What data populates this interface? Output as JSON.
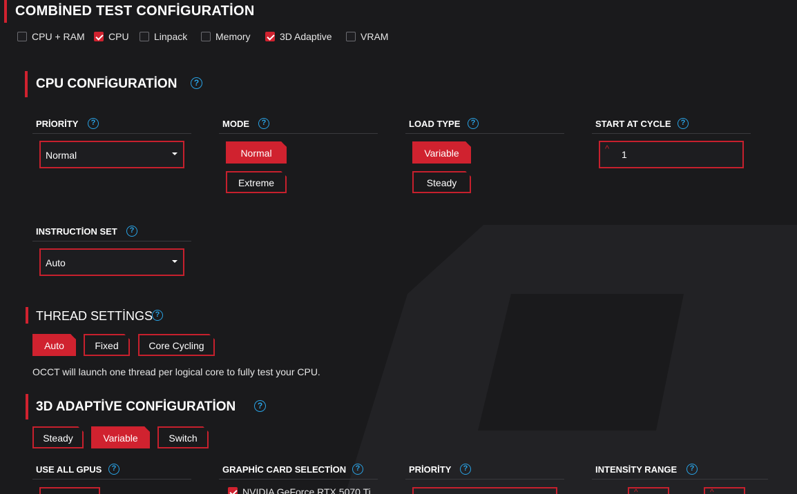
{
  "combined": {
    "title": "COMBİNED TEST CONFİGURATİON",
    "tests": [
      {
        "label": "CPU + RAM",
        "checked": false
      },
      {
        "label": "CPU",
        "checked": true
      },
      {
        "label": "Linpack",
        "checked": false
      },
      {
        "label": "Memory",
        "checked": false
      },
      {
        "label": "3D Adaptive",
        "checked": true
      },
      {
        "label": "VRAM",
        "checked": false
      }
    ]
  },
  "cpu": {
    "title": "CPU CONFİGURATİON",
    "priority": {
      "label": "PRİORİTY",
      "value": "Normal"
    },
    "mode": {
      "label": "MODE",
      "options": [
        "Normal",
        "Extreme"
      ],
      "selected": "Normal"
    },
    "load_type": {
      "label": "LOAD TYPE",
      "options": [
        "Variable",
        "Steady"
      ],
      "selected": "Variable"
    },
    "start_cycle": {
      "label": "START AT CYCLE",
      "value": "1"
    },
    "instruction_set": {
      "label": "INSTRUCTİON SET",
      "value": "Auto"
    }
  },
  "threads": {
    "title": "THREAD SETTİNGS",
    "options": [
      "Auto",
      "Fixed",
      "Core Cycling"
    ],
    "selected": "Auto",
    "description": "OCCT will launch one thread per logical core to fully test your CPU."
  },
  "adaptive": {
    "title": "3D ADAPTİVE CONFİGURATİON",
    "options": [
      "Steady",
      "Variable",
      "Switch"
    ],
    "selected": "Variable",
    "use_all_gpus": {
      "label": "USE ALL GPUS"
    },
    "gpu_selection": {
      "label": "GRAPHİC CARD SELECTİON",
      "items": [
        {
          "label": "NVIDIA GeForce RTX 5070 Ti",
          "checked": true
        }
      ]
    },
    "priority": {
      "label": "PRİORİTY"
    },
    "intensity": {
      "label": "INTENSİTY RANGE"
    }
  },
  "colors": {
    "accent": "#d0222f",
    "help": "#29a3e6",
    "background": "#1a1a1c"
  },
  "icons": {
    "help": "help-circle-icon",
    "dropdown": "chevron-down-icon",
    "stepper": "chevron-up-icon"
  }
}
